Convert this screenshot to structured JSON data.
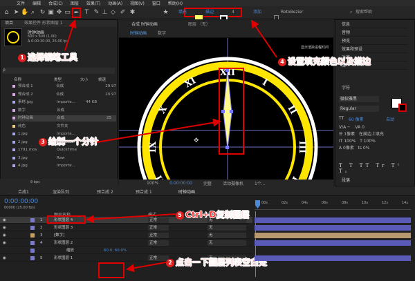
{
  "menu": [
    "文件",
    "编辑",
    "合成(C)",
    "图层",
    "效果(T)",
    "动画(A)",
    "视图(V)",
    "窗口",
    "帮助(H)"
  ],
  "toolbar": {
    "fill_label": "填充",
    "stroke_label": "描边",
    "stroke_width": "4",
    "add_label": "添加",
    "rotobezier_label": "RotoBezier",
    "search_placeholder": "搜索帮助",
    "fill_color": "#ffff66"
  },
  "project": {
    "tab": "项目",
    "effects_tab": "效果控件 形状图层 1",
    "comp_name": "时钟动画",
    "comp_size": "600 x 600 (1.00)",
    "comp_duration": "Δ 0:00:30:00, 25.00 fps",
    "search_placeholder": "ρ",
    "columns": [
      "名称",
      "类型",
      "大小",
      "帧速"
    ],
    "items": [
      {
        "name": "预合成 1",
        "type": "合成",
        "size": "",
        "fps": "29.97",
        "color": "#d8a8e8"
      },
      {
        "name": "预合成 2",
        "type": "合成",
        "size": "",
        "fps": "29.97",
        "color": "#d8a8e8"
      },
      {
        "name": "素材.jpg",
        "type": "Importe...",
        "size": "44 KB",
        "fps": "",
        "color": "#a8a8e8"
      },
      {
        "name": "数字",
        "type": "合成",
        "size": "",
        "fps": "",
        "color": "#d8a8e8"
      },
      {
        "name": "时钟动画",
        "type": "合成",
        "size": "",
        "fps": "25",
        "color": "#d8a8e8"
      },
      {
        "name": "纯色",
        "type": "文件夹",
        "size": "",
        "fps": "",
        "color": "#e8d080"
      },
      {
        "name": "1.jpg",
        "type": "Importe...",
        "size": "",
        "fps": "",
        "color": "#a8a8e8"
      },
      {
        "name": "2.jpg",
        "type": "Importe...",
        "size": "",
        "fps": "",
        "color": "#a8a8e8"
      },
      {
        "name": "1791.mov",
        "type": "QuickTime",
        "size": "",
        "fps": "",
        "color": "#a8a8e8"
      },
      {
        "name": "3.jpg",
        "type": "Raw",
        "size": "",
        "fps": "",
        "color": "#a8a8e8"
      },
      {
        "name": "4.jpg",
        "type": "Importe...",
        "size": "",
        "fps": "",
        "color": "#a8a8e8"
      }
    ],
    "bpc": "8 bpc"
  },
  "comp_panel": {
    "tab": "合成 时钟动画",
    "layer_tab": "图层 （无）",
    "subtabs": [
      "时钟动画",
      "数字"
    ],
    "hint": "显示渲染进程时间",
    "roman": [
      "XII",
      "I",
      "II",
      "III",
      "IIII",
      "V",
      "VI",
      "VII",
      "VIII",
      "IX",
      "X",
      "XI"
    ],
    "footer": [
      "100%",
      "0:00:00:00",
      "完整",
      "活动摄像机",
      "1个..."
    ]
  },
  "right_panel": {
    "items": [
      "信息",
      "音频",
      "预览",
      "效果和预设",
      "对齐",
      "库"
    ],
    "char_title": "字符",
    "font": "微软雅黑",
    "style": "Regular",
    "size": "60 像素",
    "leading": "自动",
    "paragraph": "段落"
  },
  "timeline": {
    "tabs": [
      "合成1",
      "渲染队列",
      "预合成 2",
      "预合成 1",
      "时钟动画"
    ],
    "time": "0:00:00:00",
    "time_sub": "00000 (25.00 fps)",
    "col_name": "图层名称",
    "col_mode": "模式",
    "col_parent": "父级",
    "ruler": [
      "00s",
      "02s",
      "04s",
      "06s",
      "08s",
      "10s",
      "12s",
      "14s"
    ],
    "layers": [
      {
        "num": "1",
        "name": "形状图层 4",
        "mode": "正常",
        "parent": "无",
        "color": "#7a7acc"
      },
      {
        "num": "2",
        "name": "形状图层 3",
        "mode": "正常",
        "parent": "无",
        "color": "#7a7acc"
      },
      {
        "num": "3",
        "name": "[数字]",
        "mode": "正常",
        "parent": "无",
        "color": "#c8a060"
      },
      {
        "num": "4",
        "name": "形状图层 2",
        "mode": "正常",
        "parent": "无",
        "color": "#7a7acc"
      },
      {
        "num": "",
        "name": "缩放",
        "mode": "",
        "parent": "",
        "color": "#7a7acc"
      },
      {
        "num": "5",
        "name": "形状图层 1",
        "mode": "正常",
        "parent": "无",
        "color": "#7a7acc"
      }
    ],
    "scale_value": "60.0, 60.0%"
  },
  "annotations": [
    {
      "n": "1",
      "text": "选择钢笔工具"
    },
    {
      "n": "2",
      "text": "点击一下图层列表空白处"
    },
    {
      "n": "3",
      "text": "绘制一个分针"
    },
    {
      "n": "4",
      "text": "设置填充颜色以及描边"
    },
    {
      "n": "5",
      "text": "Ctrl+D复制图层"
    }
  ]
}
